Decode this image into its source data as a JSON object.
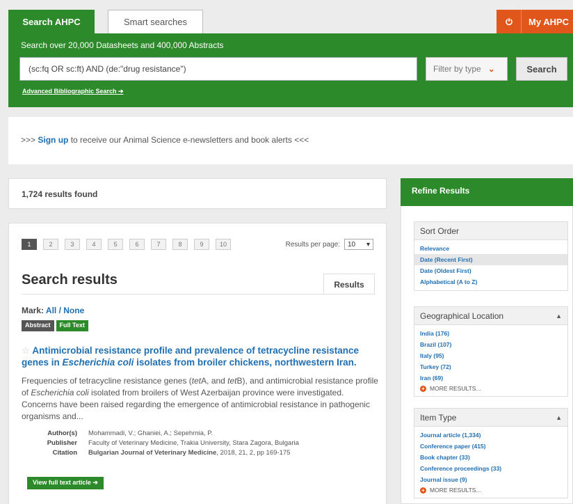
{
  "header": {
    "tab_search": "Search AHPC",
    "tab_smart": "Smart searches",
    "my_ahpc": "My AHPC",
    "caption": "Search over 20,000 Datasheets and 400,000 Abstracts",
    "query": "(sc:fq OR sc:ft) AND (de:\"drug resistance\")",
    "filter_label": "Filter by type",
    "search_button": "Search",
    "advanced_link": "Advanced Bibliographic Search ➔"
  },
  "signup": {
    "prefix": ">>> ",
    "link": "Sign up",
    "suffix": " to receive our Animal Science e-newsletters and book alerts <<<"
  },
  "results_count": "1,724 results found",
  "pager": {
    "pages": [
      "1",
      "2",
      "3",
      "4",
      "5",
      "6",
      "7",
      "8",
      "9",
      "10"
    ],
    "results_per_page_label": "Results per page:",
    "results_per_page_value": "10"
  },
  "results": {
    "title": "Search results",
    "tab": "Results",
    "mark_label": "Mark:",
    "mark_all": "All",
    "mark_sep": " / ",
    "mark_none": "None",
    "badge_abstract": "Abstract",
    "badge_fulltext": "Full Text",
    "article": {
      "title_part1": "Antimicrobial resistance profile and prevalence of tetracycline resistance genes in ",
      "title_italic": "Escherichia coli",
      "title_part2": " isolates from broiler chickens, northwestern Iran.",
      "abstract_a": "Frequencies of tetracycline resistance genes (",
      "abstract_tetA": "tet",
      "abstract_b": "A, and ",
      "abstract_tetB": "tet",
      "abstract_c": "B), and antimicrobial resistance profile of ",
      "abstract_ecoli": "Escherichia coli",
      "abstract_d": " isolated from broilers of West Azerbaijan province were investigated. Concerns have been raised regarding the emergence of antimicrobial resistance in pathogenic organisms and...",
      "meta": [
        {
          "key": "Author(s)",
          "value": "Mohammadi, V.; Ghaniei, A.; Sepehrnia, P."
        },
        {
          "key": "Publisher",
          "value": "Faculty of Veterinary Medicine, Trakia University, Stara Zagora, Bulgaria"
        },
        {
          "key": "Citation",
          "value_bold": "Bulgarian Journal of Veterinary Medicine",
          "value": ", 2018, 21, 2, pp 169-175"
        }
      ],
      "view_button": "View full text article ➔"
    }
  },
  "sidebar": {
    "title": "Refine Results",
    "sort": {
      "title": "Sort Order",
      "items": [
        "Relevance",
        "Date (Recent First)",
        "Date (Oldest First)",
        "Alphabetical (A to Z)"
      ]
    },
    "geo": {
      "title": "Geographical Location",
      "items": [
        "India (176)",
        "Brazil (107)",
        "Italy (95)",
        "Turkey (72)",
        "Iran (69)"
      ],
      "more": "MORE RESULTS..."
    },
    "itemtype": {
      "title": "Item Type",
      "items": [
        "Journal article (1,334)",
        "Conference paper (415)",
        "Book chapter (33)",
        "Conference proceedings (33)",
        "Journal issue (9)"
      ],
      "more": "MORE RESULTS..."
    }
  }
}
